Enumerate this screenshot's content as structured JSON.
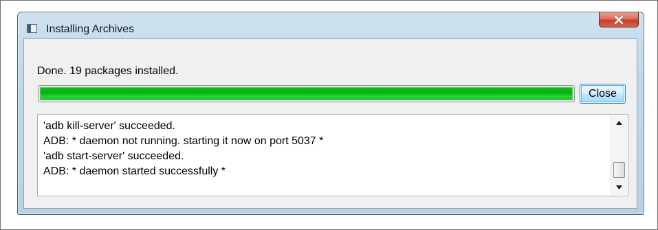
{
  "window": {
    "title": "Installing Archives",
    "icon": "app-window-icon",
    "close_icon": "close-x-icon"
  },
  "status": {
    "text": "Done. 19 packages installed.",
    "progress_fraction": 1.0,
    "progress_color": "#0cbf16"
  },
  "buttons": {
    "close_label": "Close"
  },
  "log": {
    "lines": [
      "'adb kill-server' succeeded.",
      "ADB: * daemon not running. starting it now on port 5037 *",
      "'adb start-server' succeeded.",
      "ADB: * daemon started successfully *"
    ],
    "scrollbar_up_icon": "scroll-up-arrow-icon",
    "scrollbar_down_icon": "scroll-down-arrow-icon"
  }
}
